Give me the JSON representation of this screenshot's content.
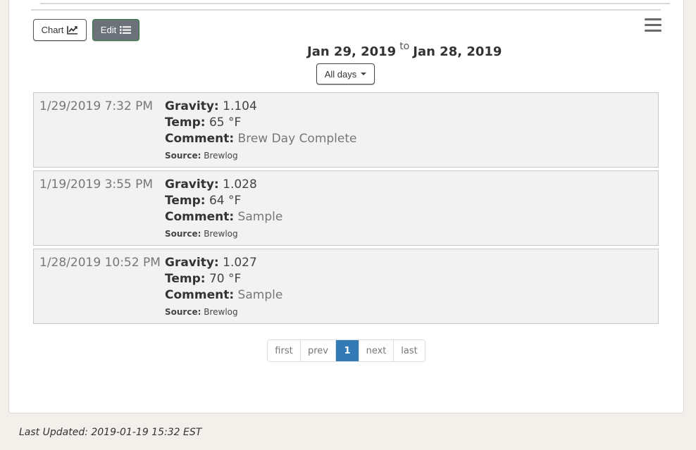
{
  "toolbar": {
    "chart_label": "Chart",
    "edit_label": "Edit"
  },
  "range": {
    "start": "Jan 29, 2019",
    "connector": "to",
    "end": "Jan 28, 2019",
    "filter": "All days"
  },
  "labels": {
    "gravity": "Gravity:",
    "temp": "Temp:",
    "comment": "Comment:",
    "source": "Source:"
  },
  "entries": [
    {
      "timestamp": "1/29/2019 7:32 PM",
      "gravity": "1.104",
      "temp": "65 °F",
      "comment": "Brew Day Complete",
      "source": "Brewlog"
    },
    {
      "timestamp": "1/19/2019 3:55 PM",
      "gravity": "1.028",
      "temp": "64 °F",
      "comment": "Sample",
      "source": "Brewlog"
    },
    {
      "timestamp": "1/28/2019 10:52 PM",
      "gravity": "1.027",
      "temp": "70 °F",
      "comment": "Sample",
      "source": "Brewlog"
    }
  ],
  "pagination": {
    "first": "first",
    "prev": "prev",
    "current": "1",
    "next": "next",
    "last": "last"
  },
  "footer": {
    "last_updated": "Last Updated: 2019-01-19 15:32 EST"
  },
  "colors": {
    "page_background": "#f3f0ec",
    "active_page": "#337ab7",
    "edit_button": "#6b727a",
    "edit_button_border": "#2f7a3e"
  }
}
